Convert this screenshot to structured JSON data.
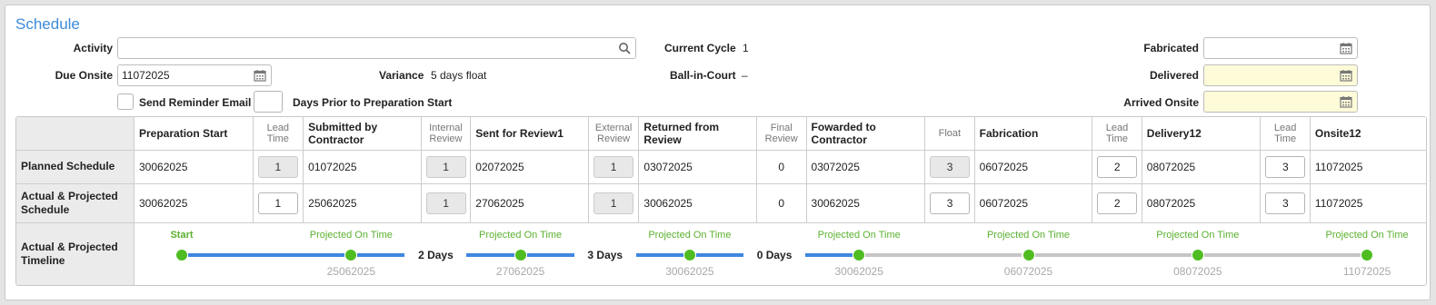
{
  "title": "Schedule",
  "fields": {
    "activity_label": "Activity",
    "activity_value": "",
    "due_onsite_label": "Due Onsite",
    "due_onsite_value": "11072025",
    "variance_label": "Variance",
    "variance_value": "5 days float",
    "current_cycle_label": "Current Cycle",
    "current_cycle_value": "1",
    "ball_in_court_label": "Ball-in-Court",
    "ball_in_court_value": "–",
    "fabricated_label": "Fabricated",
    "fabricated_value": "",
    "delivered_label": "Delivered",
    "delivered_value": "",
    "arrived_onsite_label": "Arrived Onsite",
    "arrived_onsite_value": "",
    "send_reminder_label": "Send Reminder Email",
    "send_reminder_checked": false,
    "days_prior_value": "",
    "days_prior_label": "Days Prior to Preparation Start"
  },
  "grid": {
    "headers": {
      "prep_start": "Preparation Start",
      "lead_time_1": [
        "Lead",
        "Time"
      ],
      "submitted": [
        "Submitted by",
        "Contractor"
      ],
      "internal_review": [
        "Internal",
        "Review"
      ],
      "sent_review": "Sent for Review1",
      "external_review": [
        "External",
        "Review"
      ],
      "returned": [
        "Returned from",
        "Review"
      ],
      "final_review": [
        "Final",
        "Review"
      ],
      "forwarded": [
        "Fowarded to",
        "Contractor"
      ],
      "float": "Float",
      "fabrication": "Fabrication",
      "lead_time_2": [
        "Lead",
        "Time"
      ],
      "delivery": "Delivery12",
      "lead_time_3": [
        "Lead",
        "Time"
      ],
      "onsite": "Onsite12"
    },
    "rows": [
      {
        "label": [
          "Planned Schedule"
        ],
        "prep_start": "30062025",
        "lead_time_1": "1",
        "submitted": "01072025",
        "internal_review": "1",
        "sent_review": "02072025",
        "external_review": "1",
        "returned": "03072025",
        "final_review": "0",
        "forwarded": "03072025",
        "float": "3",
        "fabrication": "06072025",
        "lead_time_2": "2",
        "delivery": "08072025",
        "lead_time_3": "3",
        "onsite": "11072025"
      },
      {
        "label": [
          "Actual & Projected",
          "Schedule"
        ],
        "prep_start": "30062025",
        "lead_time_1": "1",
        "submitted": "25062025",
        "internal_review": "1",
        "sent_review": "27062025",
        "external_review": "1",
        "returned": "30062025",
        "final_review": "0",
        "forwarded": "30062025",
        "float": "3",
        "fabrication": "06072025",
        "lead_time_2": "2",
        "delivery": "08072025",
        "lead_time_3": "3",
        "onsite": "11072025"
      }
    ],
    "timeline_label": [
      "Actual & Projected",
      "Timeline"
    ]
  },
  "timeline": {
    "start_label": "Start",
    "status_label": "Projected On Time",
    "milestone_dates": [
      "25062025",
      "27062025",
      "30062025",
      "30062025",
      "06072025",
      "08072025",
      "11072025"
    ],
    "gap_labels": [
      "2 Days",
      "3 Days",
      "0 Days"
    ]
  },
  "colors": {
    "title": "#3d8bd9",
    "on_time": "#5bb130",
    "dot": "#4fbd22",
    "bar_actual": "#3f86e0",
    "bar_projected": "#c6c6c6",
    "highlight_field": "#fefbd8"
  },
  "icons": {
    "activity": "search-icon",
    "date": "calendar-icon"
  }
}
